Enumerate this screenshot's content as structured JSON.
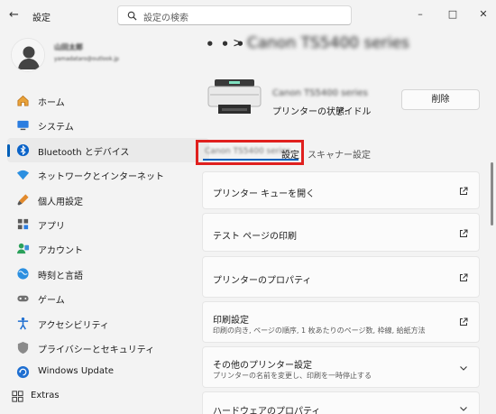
{
  "window": {
    "title": "設定",
    "search_placeholder": "設定の検索",
    "minimize": "–",
    "maximize": "□",
    "close": "✕"
  },
  "profile": {
    "name": "山田太郎",
    "email": "yamadataro@outlook.jp"
  },
  "sidebar": {
    "items": [
      {
        "label": "ホーム",
        "icon": "home-icon"
      },
      {
        "label": "システム",
        "icon": "system-icon"
      },
      {
        "label": "Bluetooth とデバイス",
        "icon": "bluetooth-icon",
        "active": true
      },
      {
        "label": "ネットワークとインターネット",
        "icon": "network-icon"
      },
      {
        "label": "個人用設定",
        "icon": "personalization-icon"
      },
      {
        "label": "アプリ",
        "icon": "apps-icon"
      },
      {
        "label": "アカウント",
        "icon": "account-icon"
      },
      {
        "label": "時刻と言語",
        "icon": "time-language-icon"
      },
      {
        "label": "ゲーム",
        "icon": "gaming-icon"
      },
      {
        "label": "アクセシビリティ",
        "icon": "accessibility-icon"
      },
      {
        "label": "プライバシーとセキュリティ",
        "icon": "privacy-icon"
      },
      {
        "label": "Windows Update",
        "icon": "windows-update-icon"
      }
    ],
    "extras": "Extras"
  },
  "breadcrumb": {
    "ellipsis": "• • •",
    "separator": ">",
    "title": "Canon TS5400 series"
  },
  "device": {
    "name": "Canon TS5400 series",
    "status_label": "プリンターの状態:",
    "status_value": "アイドル",
    "delete_label": "削除"
  },
  "tabs": {
    "tab1_model": "Canon TS5400 series",
    "tab1_label": "設定",
    "tab2_label": "スキャナー設定"
  },
  "cards": [
    {
      "title": "プリンター キューを開く",
      "action": "open-external"
    },
    {
      "title": "テスト ページの印刷",
      "action": "open-external"
    },
    {
      "title": "プリンターのプロパティ",
      "action": "open-external"
    },
    {
      "title": "印刷設定",
      "subtitle": "印刷の向き, ページの順序, 1 枚あたりのページ数, 枠線, 給紙方法",
      "action": "open-external"
    },
    {
      "title": "その他のプリンター設定",
      "subtitle": "プリンターの名前を変更し、印刷を一時停止する",
      "action": "expand"
    },
    {
      "title": "ハードウェアのプロパティ",
      "action": "expand"
    }
  ],
  "colors": {
    "accent": "#005fb8",
    "highlight": "#e0201e",
    "background": "#f3f3f3"
  }
}
